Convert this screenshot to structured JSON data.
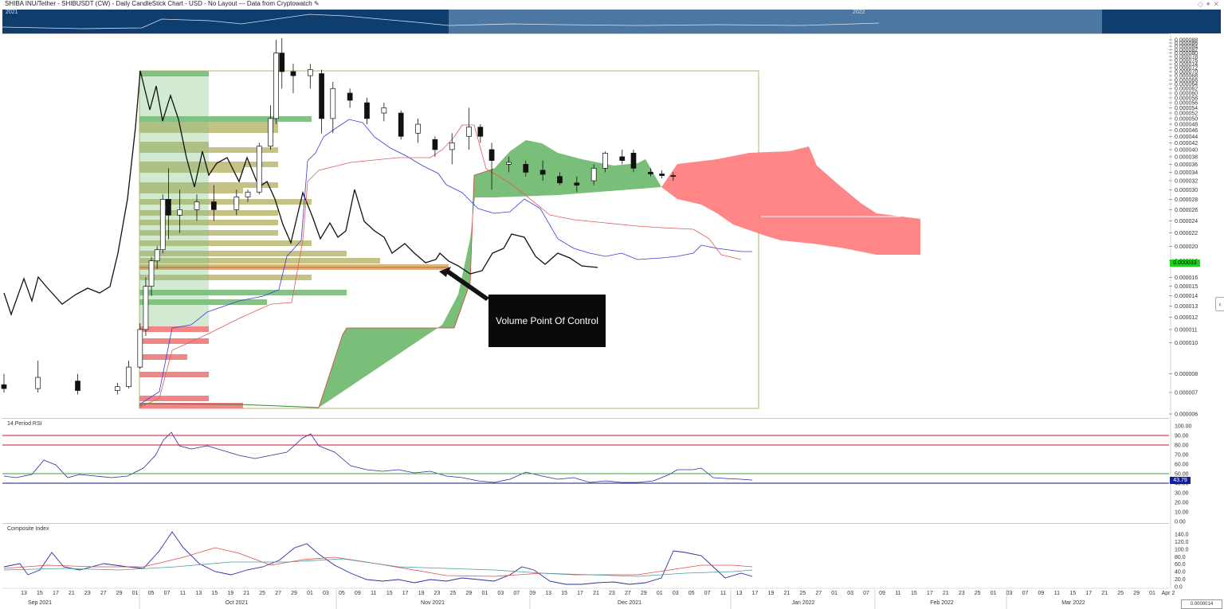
{
  "header": {
    "title": "SHIBA INU/Tether - SHIBUSDT (CW) - Daily CandleStick Chart - USD - No Layout --- Data from Cryptowatch",
    "edit_icon": "pencil-icon",
    "right_icons": [
      "diamond-icon",
      "pin-icon",
      "close-icon"
    ]
  },
  "navigator": {
    "labels": [
      "2021",
      "2022"
    ]
  },
  "callout": {
    "text": "Volume Point Of Control"
  },
  "price_pane": {
    "last_price": "0.000033",
    "last_price_color": "#1fd11f",
    "axis_ticks": [
      "0.000088",
      "0.000086",
      "0.000084",
      "0.000082",
      "0.000080",
      "0.000078",
      "0.000076",
      "0.000074",
      "0.000072",
      "0.000070",
      "0.000068",
      "0.000066",
      "0.000064",
      "0.000062",
      "0.000060",
      "0.000058",
      "0.000056",
      "0.000054",
      "0.000052",
      "0.000050",
      "0.000048",
      "0.000046",
      "0.000044",
      "0.000042",
      "0.000040",
      "0.000038",
      "0.000036",
      "0.000034",
      "0.000032",
      "0.000030",
      "0.000028",
      "0.000026",
      "0.000024",
      "0.000022",
      "0.000020",
      "0.000018",
      "0.000016",
      "0.000015",
      "0.000014",
      "0.000013",
      "0.000012",
      "0.000011",
      "0.000010",
      "0.000008",
      "0.000007",
      "0.000006"
    ]
  },
  "rsi_pane": {
    "label": "14 Period RSI",
    "last_value": "43.79",
    "last_value_color": "#121ea0",
    "axis_ticks": [
      "100.00",
      "90.00",
      "80.00",
      "70.00",
      "60.00",
      "50.00",
      "40.00",
      "30.00",
      "20.00",
      "10.00",
      "0.00"
    ]
  },
  "ci_pane": {
    "label": "Composite Index",
    "axis_ticks": [
      "140.0",
      "120.0",
      "100.0",
      "80.0",
      "60.0",
      "40.0",
      "20.0",
      "0.0"
    ]
  },
  "x_axis": {
    "day_ticks": [
      "13",
      "15",
      "17",
      "21",
      "23",
      "27",
      "29",
      "01",
      "05",
      "07",
      "11",
      "13",
      "15",
      "19",
      "21",
      "25",
      "27",
      "29",
      "01",
      "03",
      "05",
      "09",
      "11",
      "15",
      "17",
      "19",
      "23",
      "25",
      "29",
      "01",
      "03",
      "07",
      "09",
      "13",
      "15",
      "17",
      "21",
      "23",
      "27",
      "29",
      "01",
      "03",
      "05",
      "07",
      "11",
      "13",
      "17",
      "19",
      "21",
      "25",
      "27",
      "01",
      "03",
      "07",
      "09",
      "11",
      "15",
      "17",
      "21",
      "23",
      "25",
      "01",
      "03",
      "07",
      "09",
      "11",
      "15",
      "17",
      "21",
      "25",
      "29",
      "01",
      "Apr 2"
    ],
    "month_labels": [
      "Sep 2021",
      "Oct 2021",
      "Nov 2021",
      "Dec 2021",
      "Jan 2022",
      "Feb 2022",
      "Mar 2022"
    ]
  },
  "bottom_right_box": "0.0000014",
  "chart_data": {
    "type": "candlestick",
    "title": "SHIBA INU/Tether - SHIBUSDT (CW) - Daily CandleStick Chart - USD",
    "y_scale": "log",
    "ylim": [
      6e-06,
      9e-05
    ],
    "x_range": [
      "2021-09-09",
      "2022-04-02"
    ],
    "candles": [
      {
        "date": "2021-09-09",
        "open": 7.4e-06,
        "high": 8e-06,
        "low": 7e-06,
        "close": 7.2e-06
      },
      {
        "date": "2021-09-15",
        "open": 7.2e-06,
        "high": 8.8e-06,
        "low": 7e-06,
        "close": 7.8e-06
      },
      {
        "date": "2021-09-22",
        "open": 7.6e-06,
        "high": 8e-06,
        "low": 6.9e-06,
        "close": 7.1e-06
      },
      {
        "date": "2021-09-29",
        "open": 7.1e-06,
        "high": 7.5e-06,
        "low": 6.9e-06,
        "close": 7.3e-06
      },
      {
        "date": "2021-10-01",
        "open": 7.3e-06,
        "high": 8.8e-06,
        "low": 7.2e-06,
        "close": 8.4e-06
      },
      {
        "date": "2021-10-03",
        "open": 8.4e-06,
        "high": 1.15e-05,
        "low": 8.3e-06,
        "close": 1.1e-05
      },
      {
        "date": "2021-10-04",
        "open": 1.1e-05,
        "high": 1.6e-05,
        "low": 1.05e-05,
        "close": 1.5e-05
      },
      {
        "date": "2021-10-05",
        "open": 1.5e-05,
        "high": 1.85e-05,
        "low": 1.4e-05,
        "close": 1.8e-05
      },
      {
        "date": "2021-10-06",
        "open": 1.8e-05,
        "high": 2e-05,
        "low": 1.7e-05,
        "close": 1.95e-05
      },
      {
        "date": "2021-10-07",
        "open": 1.95e-05,
        "high": 2.9e-05,
        "low": 1.9e-05,
        "close": 2.8e-05
      },
      {
        "date": "2021-10-08",
        "open": 2.8e-05,
        "high": 3.5e-05,
        "low": 2.1e-05,
        "close": 2.5e-05
      },
      {
        "date": "2021-10-10",
        "open": 2.5e-05,
        "high": 3e-05,
        "low": 2.2e-05,
        "close": 2.6e-05
      },
      {
        "date": "2021-10-13",
        "open": 2.6e-05,
        "high": 2.9e-05,
        "low": 2.4e-05,
        "close": 2.75e-05
      },
      {
        "date": "2021-10-16",
        "open": 2.75e-05,
        "high": 3.1e-05,
        "low": 2.4e-05,
        "close": 2.6e-05
      },
      {
        "date": "2021-10-20",
        "open": 2.6e-05,
        "high": 3e-05,
        "low": 2.5e-05,
        "close": 2.85e-05
      },
      {
        "date": "2021-10-22",
        "open": 2.85e-05,
        "high": 3e-05,
        "low": 2.75e-05,
        "close": 2.95e-05
      },
      {
        "date": "2021-10-24",
        "open": 2.95e-05,
        "high": 4.2e-05,
        "low": 2.9e-05,
        "close": 4.1e-05
      },
      {
        "date": "2021-10-26",
        "open": 4.1e-05,
        "high": 5.5e-05,
        "low": 4e-05,
        "close": 5e-05
      },
      {
        "date": "2021-10-27",
        "open": 5e-05,
        "high": 8.8e-05,
        "low": 4.8e-05,
        "close": 8e-05
      },
      {
        "date": "2021-10-28",
        "open": 8e-05,
        "high": 8.9e-05,
        "low": 6.2e-05,
        "close": 7e-05
      },
      {
        "date": "2021-10-30",
        "open": 7e-05,
        "high": 7.4e-05,
        "low": 6e-05,
        "close": 6.8e-05
      },
      {
        "date": "2021-11-02",
        "open": 6.8e-05,
        "high": 7.4e-05,
        "low": 6.2e-05,
        "close": 7.1e-05
      },
      {
        "date": "2021-11-04",
        "open": 6.9e-05,
        "high": 7.1e-05,
        "low": 4.5e-05,
        "close": 5e-05
      },
      {
        "date": "2021-11-06",
        "open": 5e-05,
        "high": 6.5e-05,
        "low": 4.5e-05,
        "close": 6.2e-05
      },
      {
        "date": "2021-11-09",
        "open": 6e-05,
        "high": 6.2e-05,
        "low": 5.4e-05,
        "close": 5.7e-05
      },
      {
        "date": "2021-11-12",
        "open": 5.6e-05,
        "high": 5.8e-05,
        "low": 4.8e-05,
        "close": 5e-05
      },
      {
        "date": "2021-11-15",
        "open": 5.2e-05,
        "high": 5.6e-05,
        "low": 4.9e-05,
        "close": 5.4e-05
      },
      {
        "date": "2021-11-18",
        "open": 5.2e-05,
        "high": 5.3e-05,
        "low": 4.3e-05,
        "close": 4.4e-05
      },
      {
        "date": "2021-11-21",
        "open": 4.5e-05,
        "high": 5e-05,
        "low": 4.2e-05,
        "close": 4.8e-05
      },
      {
        "date": "2021-11-24",
        "open": 4.3e-05,
        "high": 4.4e-05,
        "low": 3.8e-05,
        "close": 4e-05
      },
      {
        "date": "2021-11-27",
        "open": 4e-05,
        "high": 4.5e-05,
        "low": 3.6e-05,
        "close": 4.2e-05
      },
      {
        "date": "2021-11-30",
        "open": 4.4e-05,
        "high": 5.4e-05,
        "low": 4e-05,
        "close": 4.7e-05
      },
      {
        "date": "2021-12-02",
        "open": 4.7e-05,
        "high": 4.8e-05,
        "low": 4.2e-05,
        "close": 4.4e-05
      },
      {
        "date": "2021-12-04",
        "open": 4e-05,
        "high": 4.2e-05,
        "low": 3e-05,
        "close": 3.7e-05
      },
      {
        "date": "2021-12-07",
        "open": 3.6e-05,
        "high": 3.8e-05,
        "low": 3.4e-05,
        "close": 3.65e-05
      },
      {
        "date": "2021-12-10",
        "open": 3.6e-05,
        "high": 3.7e-05,
        "low": 3.3e-05,
        "close": 3.4e-05
      },
      {
        "date": "2021-12-13",
        "open": 3.45e-05,
        "high": 3.7e-05,
        "low": 3.2e-05,
        "close": 3.35e-05
      },
      {
        "date": "2021-12-16",
        "open": 3.3e-05,
        "high": 3.4e-05,
        "low": 3.1e-05,
        "close": 3.15e-05
      },
      {
        "date": "2021-12-19",
        "open": 3.15e-05,
        "high": 3.3e-05,
        "low": 2.95e-05,
        "close": 3.1e-05
      },
      {
        "date": "2021-12-22",
        "open": 3.2e-05,
        "high": 3.6e-05,
        "low": 3.1e-05,
        "close": 3.5e-05
      },
      {
        "date": "2021-12-24",
        "open": 3.5e-05,
        "high": 3.95e-05,
        "low": 3.4e-05,
        "close": 3.9e-05
      },
      {
        "date": "2021-12-27",
        "open": 3.8e-05,
        "high": 4e-05,
        "low": 3.6e-05,
        "close": 3.7e-05
      },
      {
        "date": "2021-12-29",
        "open": 3.9e-05,
        "high": 4e-05,
        "low": 3.4e-05,
        "close": 3.5e-05
      },
      {
        "date": "2022-01-01",
        "open": 3.4e-05,
        "high": 3.5e-05,
        "low": 3.3e-05,
        "close": 3.36e-05
      },
      {
        "date": "2022-01-03",
        "open": 3.36e-05,
        "high": 3.45e-05,
        "low": 3.25e-05,
        "close": 3.32e-05
      },
      {
        "date": "2022-01-05",
        "open": 3.32e-05,
        "high": 3.4e-05,
        "low": 3.2e-05,
        "close": 3.3e-05
      }
    ],
    "volume_profile": {
      "point_of_control": 3.3e-05,
      "point_of_control_label": "Volume Point Of Control"
    },
    "rsi": {
      "period": 14,
      "ylim": [
        0,
        100
      ],
      "levels": [
        90,
        80,
        50,
        40
      ],
      "last": 43.79
    },
    "composite_index": {
      "ylim": [
        0,
        140
      ]
    }
  }
}
